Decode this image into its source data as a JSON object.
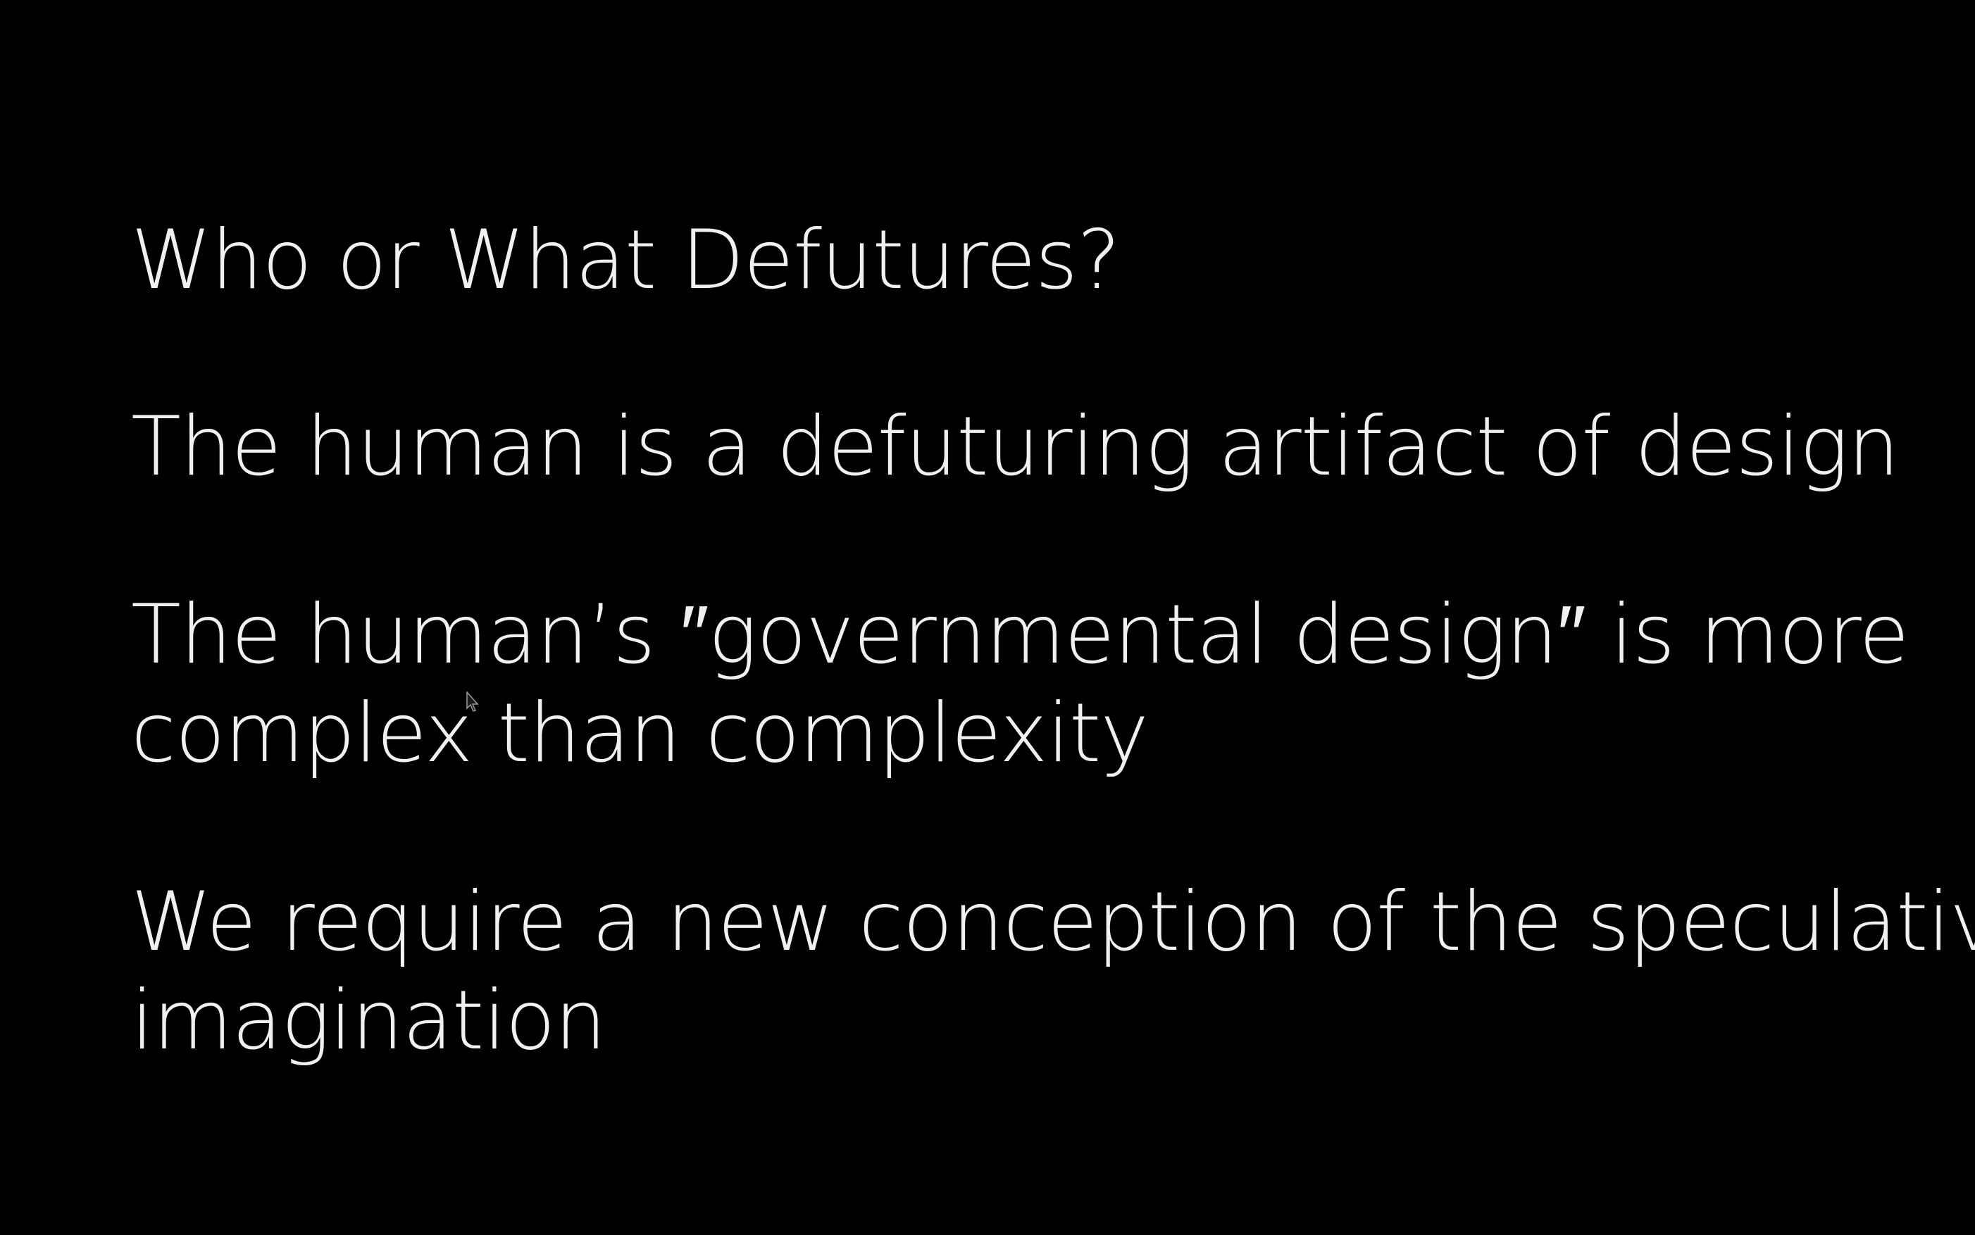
{
  "slide": {
    "heading": "Who or What Defutures?",
    "points": [
      {
        "lines": [
          "The human is a defuturing artifact of design"
        ]
      },
      {
        "lines": [
          "The human’s ″governmental design″ is more",
          "complex than complexity"
        ]
      },
      {
        "lines": [
          "We require a new conception of the speculative",
          "imagination"
        ]
      }
    ]
  },
  "colors": {
    "background": "#000000",
    "text": "#f0f0f0"
  },
  "icons": {
    "cursor": "mouse-pointer-icon"
  }
}
